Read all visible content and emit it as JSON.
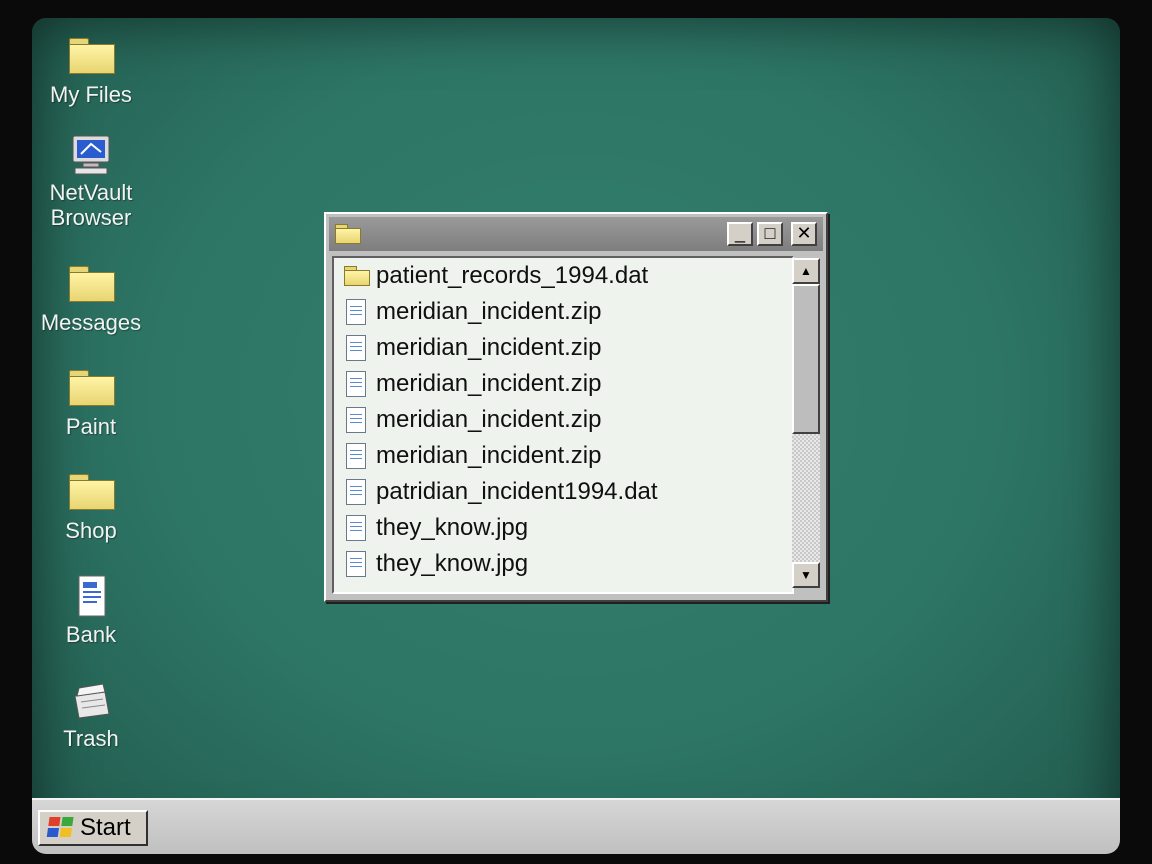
{
  "desktop": {
    "icons": [
      {
        "label": "My Files",
        "icon": "folder-icon"
      },
      {
        "label": "NetVault Browser",
        "icon": "network-computer-icon"
      },
      {
        "label": "Messages",
        "icon": "folder-icon"
      },
      {
        "label": "Paint",
        "icon": "folder-icon"
      },
      {
        "label": "Shop",
        "icon": "folder-icon"
      },
      {
        "label": "Bank",
        "icon": "document-icon"
      },
      {
        "label": "Trash",
        "icon": "recycle-bin-icon"
      }
    ],
    "background_color": "#2d7565"
  },
  "window": {
    "title": "",
    "title_icon": "folder-icon",
    "buttons": {
      "minimize": "_",
      "maximize": "□",
      "close": "✕"
    },
    "files": [
      {
        "name": "patient_records_1994.dat",
        "icon": "folder-icon"
      },
      {
        "name": "meridian_incident.zip",
        "icon": "document-icon"
      },
      {
        "name": "meridian_incident.zip",
        "icon": "document-icon"
      },
      {
        "name": "meridian_incident.zip",
        "icon": "document-icon"
      },
      {
        "name": "meridian_incident.zip",
        "icon": "document-icon"
      },
      {
        "name": "meridian_incident.zip",
        "icon": "document-icon"
      },
      {
        "name": "patridian_incident1994.dat",
        "icon": "document-icon"
      },
      {
        "name": "they_know.jpg",
        "icon": "document-icon"
      },
      {
        "name": "they_know.jpg",
        "icon": "document-icon"
      }
    ]
  },
  "taskbar": {
    "start_label": "Start"
  }
}
